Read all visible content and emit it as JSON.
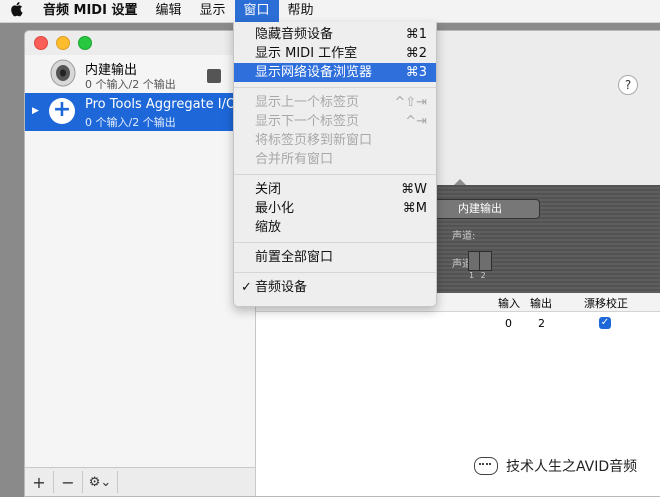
{
  "menubar": {
    "apple": "",
    "items": [
      "音频 MIDI 设置",
      "编辑",
      "显示",
      "窗口",
      "帮助"
    ]
  },
  "sidebar": {
    "devices": [
      {
        "name": "内建输出",
        "io": "0 个输入/2 个输出"
      },
      {
        "name": "Pro Tools Aggregate I/O",
        "io": "0 个输入/2 个输出"
      }
    ],
    "add_label": "+",
    "remove_label": "−",
    "gear_label": "⚙⌄"
  },
  "main": {
    "help_label": "?",
    "builtin_button": "内建输出",
    "channel_nums": "1 2",
    "partial_labels": [
      "声道:",
      "声道:"
    ],
    "table": {
      "headers": [
        "输入",
        "输出",
        "漂移校正"
      ],
      "row": {
        "in": "0",
        "out": "2",
        "drift": true
      }
    }
  },
  "dropdown": {
    "groups": [
      [
        {
          "label": "隐藏音频设备",
          "shortcut": "⌘1",
          "disabled": false,
          "highlighted": false
        },
        {
          "label": "显示 MIDI 工作室",
          "shortcut": "⌘2",
          "disabled": false,
          "highlighted": false
        },
        {
          "label": "显示网络设备浏览器",
          "shortcut": "⌘3",
          "disabled": false,
          "highlighted": true
        }
      ],
      [
        {
          "label": "显示上一个标签页",
          "shortcut": "^⇧⇥",
          "disabled": true
        },
        {
          "label": "显示下一个标签页",
          "shortcut": "^⇥",
          "disabled": true
        },
        {
          "label": "将标签页移到新窗口",
          "shortcut": "",
          "disabled": true
        },
        {
          "label": "合并所有窗口",
          "shortcut": "",
          "disabled": true
        }
      ],
      [
        {
          "label": "关闭",
          "shortcut": "⌘W",
          "disabled": false
        },
        {
          "label": "最小化",
          "shortcut": "⌘M",
          "disabled": false
        },
        {
          "label": "缩放",
          "shortcut": "",
          "disabled": false
        }
      ],
      [
        {
          "label": "前置全部窗口",
          "shortcut": "",
          "disabled": false
        }
      ],
      [
        {
          "label": "音频设备",
          "shortcut": "",
          "disabled": false,
          "checked": true
        }
      ]
    ],
    "check_mark": "✓"
  },
  "watermark": {
    "text": "技术人生之AVID音频"
  }
}
